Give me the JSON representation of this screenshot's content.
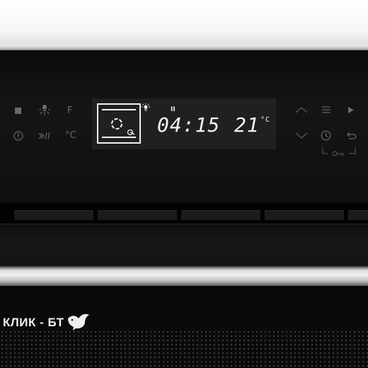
{
  "display": {
    "time": "04:15",
    "temperature": "21",
    "temperature_unit": "°C"
  },
  "left_controls": {
    "fan_function_label": "F",
    "celsius_label": "°C"
  },
  "branding": {
    "watermark_text": "КЛИК - БТ"
  },
  "colors": {
    "panel": "#111111",
    "display_background": "#202020",
    "display_text": "#f4f4f4",
    "control_icons": "#6a6a6a",
    "steel": "#d9d9d9"
  },
  "icons": [
    "stop-icon",
    "light-icon",
    "fast-preheat-icon",
    "info-icon",
    "oven-mode-icon",
    "lightbulb-indicator-icon",
    "pause-indicator-icon",
    "up-arrow-icon",
    "down-arrow-icon",
    "menu-icon",
    "play-icon",
    "clock-icon",
    "back-icon",
    "key-lock-icon"
  ]
}
